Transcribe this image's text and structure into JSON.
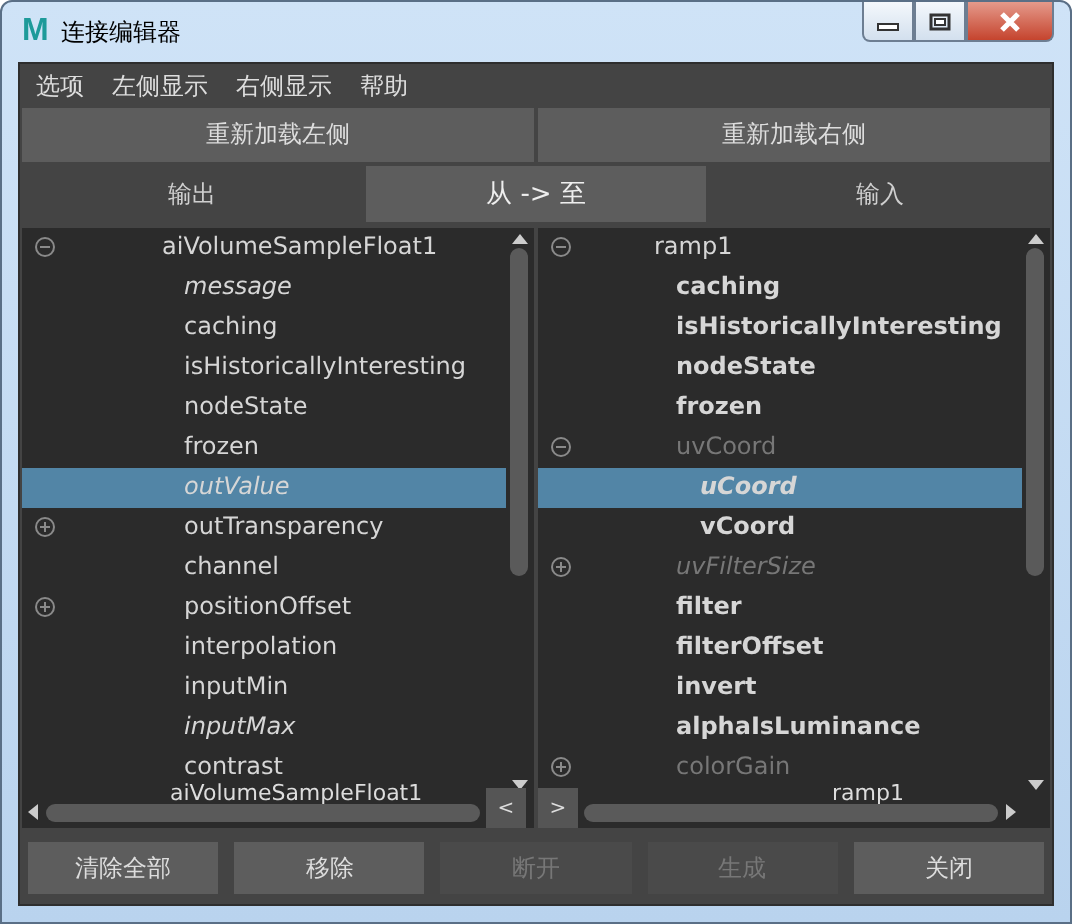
{
  "window": {
    "logo": "M",
    "title": "连接编辑器"
  },
  "menu": [
    "选项",
    "左侧显示",
    "右侧显示",
    "帮助"
  ],
  "reload_buttons": [
    "重新加载左侧",
    "重新加载右侧"
  ],
  "tabs": [
    {
      "label": "输出",
      "selected": false
    },
    {
      "label": "从 -> 至",
      "selected": true
    },
    {
      "label": "输入",
      "selected": false
    }
  ],
  "left": {
    "footer": "aiVolumeSampleFloat1",
    "tree": [
      {
        "label": "aiVolumeSampleFloat1",
        "expanded": true,
        "italic": false,
        "bold": false,
        "dim": false,
        "selected": false,
        "children": [
          {
            "label": "message",
            "italic": true,
            "bold": false,
            "dim": false,
            "selected": false
          },
          {
            "label": "caching",
            "italic": false,
            "bold": false,
            "dim": false,
            "selected": false
          },
          {
            "label": "isHistoricallyInteresting",
            "italic": false,
            "bold": false,
            "dim": false,
            "selected": false
          },
          {
            "label": "nodeState",
            "italic": false,
            "bold": false,
            "dim": false,
            "selected": false
          },
          {
            "label": "frozen",
            "italic": false,
            "bold": false,
            "dim": false,
            "selected": false
          },
          {
            "label": "outValue",
            "italic": true,
            "bold": false,
            "dim": false,
            "selected": true
          },
          {
            "label": "outTransparency",
            "expanded": false,
            "italic": false,
            "bold": false,
            "dim": false,
            "selected": false
          },
          {
            "label": "channel",
            "italic": false,
            "bold": false,
            "dim": false,
            "selected": false
          },
          {
            "label": "positionOffset",
            "expanded": false,
            "italic": false,
            "bold": false,
            "dim": false,
            "selected": false
          },
          {
            "label": "interpolation",
            "italic": false,
            "bold": false,
            "dim": false,
            "selected": false
          },
          {
            "label": "inputMin",
            "italic": false,
            "bold": false,
            "dim": false,
            "selected": false
          },
          {
            "label": "inputMax",
            "italic": true,
            "bold": false,
            "dim": false,
            "selected": false
          },
          {
            "label": "contrast",
            "italic": false,
            "bold": false,
            "dim": false,
            "selected": false
          }
        ]
      }
    ]
  },
  "right": {
    "footer": "ramp1",
    "tree": [
      {
        "label": "ramp1",
        "expanded": true,
        "italic": false,
        "bold": false,
        "dim": false,
        "selected": false,
        "children": [
          {
            "label": "caching",
            "italic": false,
            "bold": true,
            "dim": false,
            "selected": false
          },
          {
            "label": "isHistoricallyInteresting",
            "italic": false,
            "bold": true,
            "dim": false,
            "selected": false
          },
          {
            "label": "nodeState",
            "italic": false,
            "bold": true,
            "dim": false,
            "selected": false
          },
          {
            "label": "frozen",
            "italic": false,
            "bold": true,
            "dim": false,
            "selected": false
          },
          {
            "label": "uvCoord",
            "expanded": true,
            "italic": false,
            "bold": false,
            "dim": true,
            "selected": false,
            "children": [
              {
                "label": "uCoord",
                "italic": true,
                "bold": true,
                "dim": false,
                "selected": true
              },
              {
                "label": "vCoord",
                "italic": false,
                "bold": true,
                "dim": false,
                "selected": false
              }
            ]
          },
          {
            "label": "uvFilterSize",
            "expanded": false,
            "italic": true,
            "bold": false,
            "dim": true,
            "selected": false
          },
          {
            "label": "filter",
            "italic": false,
            "bold": true,
            "dim": false,
            "selected": false
          },
          {
            "label": "filterOffset",
            "italic": false,
            "bold": true,
            "dim": false,
            "selected": false
          },
          {
            "label": "invert",
            "italic": false,
            "bold": true,
            "dim": false,
            "selected": false
          },
          {
            "label": "alphaIsLuminance",
            "italic": false,
            "bold": true,
            "dim": false,
            "selected": false
          },
          {
            "label": "colorGain",
            "expanded": false,
            "italic": false,
            "bold": false,
            "dim": true,
            "selected": false
          }
        ]
      }
    ]
  },
  "shift_buttons": [
    "<",
    ">"
  ],
  "bottom_buttons": [
    {
      "label": "清除全部",
      "disabled": false
    },
    {
      "label": "移除",
      "disabled": false
    },
    {
      "label": "断开",
      "disabled": true
    },
    {
      "label": "生成",
      "disabled": true
    },
    {
      "label": "关闭",
      "disabled": false
    }
  ]
}
